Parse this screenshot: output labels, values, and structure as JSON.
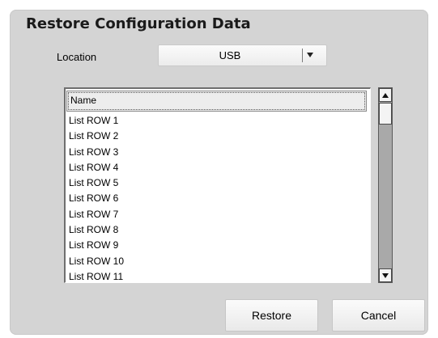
{
  "dialog": {
    "title": "Restore Configuration Data"
  },
  "location": {
    "label": "Location",
    "selected": "USB",
    "dropdown_icon": "chevron-down-icon"
  },
  "list": {
    "column_header": "Name",
    "rows": [
      "List ROW 1",
      "List ROW 2",
      "List ROW 3",
      "List ROW 4",
      "List ROW 5",
      "List ROW 6",
      "List ROW 7",
      "List ROW 8",
      "List ROW 9",
      "List ROW 10",
      "List ROW 11"
    ]
  },
  "scrollbar": {
    "up_icon": "arrow-up-icon",
    "down_icon": "arrow-down-icon"
  },
  "buttons": {
    "restore": "Restore",
    "cancel": "Cancel"
  },
  "colors": {
    "panel_bg": "#d4d4d4",
    "scroll_track": "#a9a9a9"
  }
}
